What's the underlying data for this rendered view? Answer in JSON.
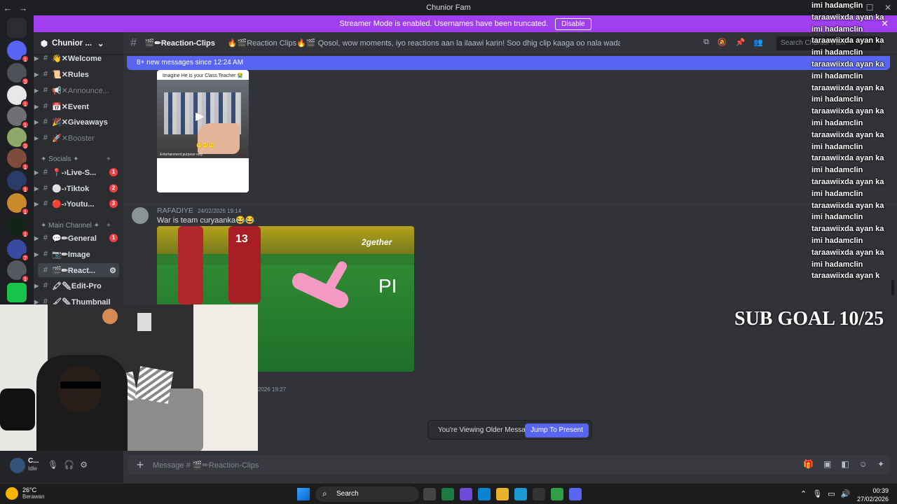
{
  "titlebar": {
    "title": "Chunior Fam",
    "back": "←",
    "forward": "→"
  },
  "banner": {
    "text": "Streamer Mode is enabled. Usernames have been truncated.",
    "button": "Disable",
    "close": "✕"
  },
  "server": {
    "name": "Chunior ...",
    "chevron": "⌄"
  },
  "channels": [
    {
      "label": "👋✕Welcome",
      "muted": false,
      "badge": ""
    },
    {
      "label": "📜✕Rules",
      "muted": false,
      "badge": ""
    },
    {
      "label": "📢✕Announce...",
      "muted": true,
      "badge": ""
    },
    {
      "label": "📅✕Event",
      "muted": false,
      "badge": ""
    },
    {
      "label": "🎉✕Giveaways",
      "muted": false,
      "badge": ""
    },
    {
      "label": "🚀✕Booster",
      "muted": true,
      "badge": ""
    },
    {
      "label": "📍-›Live-S...",
      "muted": false,
      "badge": "1"
    },
    {
      "label": "⚪-›Tiktok",
      "muted": false,
      "badge": "2"
    },
    {
      "label": "🔴-›Youtu...",
      "muted": false,
      "badge": "3"
    },
    {
      "label": "💬✏General",
      "muted": false,
      "badge": "1"
    },
    {
      "label": "📷✏Image",
      "muted": false,
      "badge": ""
    },
    {
      "label": "🎬✏React...",
      "muted": false,
      "badge": ""
    },
    {
      "label": "🖍✏Edit-Pro",
      "muted": false,
      "badge": ""
    },
    {
      "label": "🖌✏Thumbnail",
      "muted": false,
      "badge": ""
    }
  ],
  "categories": {
    "socials": "✦ Socials ✦",
    "main": "✦ Main Channel ✦"
  },
  "guild_badges": [
    "1",
    "3",
    "1",
    "1",
    "3",
    "1",
    "1",
    "1",
    "1",
    "1",
    "7",
    "1"
  ],
  "header": {
    "channel": "🎬✏Reaction-Clips",
    "topic": "🔥🎬Reaction Clips🔥🎬 Qosol, wow moments, iyo reactions aan la ilaawi karin! Soo dhig clip kaaga oo nala wadaag falcelintaada😆",
    "search_placeholder": "Search Chunior Fam"
  },
  "new_messages": "8+ new messages since 12:24 AM",
  "message1": {
    "image_caption": "Imagine He is your Class Teacher 😭",
    "image_footer": "Entertainment purpose only",
    "emoji": "😶😶😶"
  },
  "message2": {
    "author": "RAFADIYE",
    "timestamp": "24/02/2026 19:14",
    "text": "War is team curyaanka😂😂",
    "video_logo": "2gether",
    "video_logo2": "PI",
    "jersey": "13"
  },
  "message3": {
    "timestamp": "2026 19:27"
  },
  "older": {
    "text": "You're Viewing Older Messages",
    "button": "Jump To Present"
  },
  "composer": {
    "placeholder": "Message # 🎬✏Reaction-Clips",
    "plus": "+"
  },
  "user": {
    "name": "C...",
    "status": "Idle"
  },
  "overlay": {
    "chat": [
      "imi hadamclin",
      "taraawiixda ayan ka",
      "imi hadamclin",
      "taraawiixda ayan ka",
      "imi hadamclin",
      "taraawiixda ayan ka",
      "imi hadamclin",
      "taraawiixda ayan ka",
      "imi hadamclin",
      "taraawiixda ayan ka",
      "imi hadamclin",
      "taraawiixda ayan ka",
      "imi hadamclin",
      "taraawiixda ayan ka",
      "imi hadamclin",
      "taraawiixda ayan ka",
      "imi hadamclin",
      "taraawiixda ayan ka",
      "imi hadamclin",
      "taraawiixda ayan ka",
      "imi hadamclin",
      "taraawiixda ayan ka",
      "imi hadamclin",
      "taraawiixda ayan k"
    ],
    "sub_goal": "SUB GOAL 10/25"
  },
  "taskbar": {
    "temp": "26°C",
    "weather": "Berawan",
    "search": "Search",
    "time": "00:39",
    "date": "27/02/2026"
  }
}
